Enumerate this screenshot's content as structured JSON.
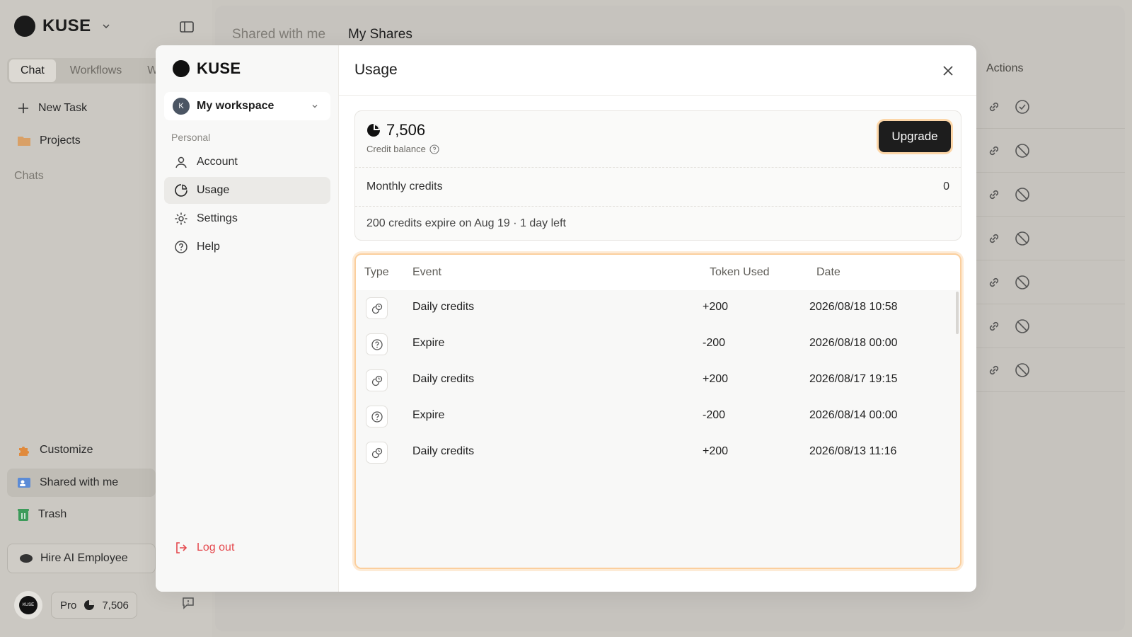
{
  "app": {
    "brand": "KUSE",
    "mode_tabs": [
      "Chat",
      "Workflows",
      "W"
    ],
    "new_task": "New Task",
    "projects": "Projects",
    "chats_section": "Chats",
    "customize": "Customize",
    "shared_with_me": "Shared with me",
    "trash": "Trash",
    "hire_ai": "Hire AI Employee",
    "avatar_text": "KUSE",
    "plan": "Pro",
    "plan_credits": "7,506"
  },
  "main": {
    "tabs": [
      "Shared with me",
      "My Shares"
    ],
    "actions_header": "Actions"
  },
  "modal": {
    "brand": "KUSE",
    "workspace": {
      "initial": "K",
      "name": "My workspace"
    },
    "section_personal": "Personal",
    "nav": [
      {
        "label": "Account",
        "icon": "user-icon"
      },
      {
        "label": "Usage",
        "icon": "usage-icon"
      },
      {
        "label": "Settings",
        "icon": "gear-icon"
      },
      {
        "label": "Help",
        "icon": "help-icon"
      }
    ],
    "logout": "Log out",
    "title": "Usage",
    "credit_balance": "7,506",
    "credit_balance_label": "Credit balance",
    "upgrade": "Upgrade",
    "monthly_credits_label": "Monthly credits",
    "monthly_credits_value": "0",
    "expire_note": "200 credits expire on Aug 19 · 1 day left",
    "table": {
      "columns": [
        "Type",
        "Event",
        "Token Used",
        "Date"
      ],
      "rows": [
        {
          "icon": "credits-icon",
          "event": "Daily credits",
          "tokens": "+200",
          "date": "2026/08/18 10:58"
        },
        {
          "icon": "help-icon",
          "event": "Expire",
          "tokens": "-200",
          "date": "2026/08/18 00:00"
        },
        {
          "icon": "credits-icon",
          "event": "Daily credits",
          "tokens": "+200",
          "date": "2026/08/17 19:15"
        },
        {
          "icon": "help-icon",
          "event": "Expire",
          "tokens": "-200",
          "date": "2026/08/14 00:00"
        },
        {
          "icon": "credits-icon",
          "event": "Daily credits",
          "tokens": "+200",
          "date": "2026/08/13 11:16"
        }
      ]
    }
  },
  "colors": {
    "accent_orange": "#fbcf9e",
    "danger": "#e5484d",
    "dark_button": "#1d1d1d"
  }
}
